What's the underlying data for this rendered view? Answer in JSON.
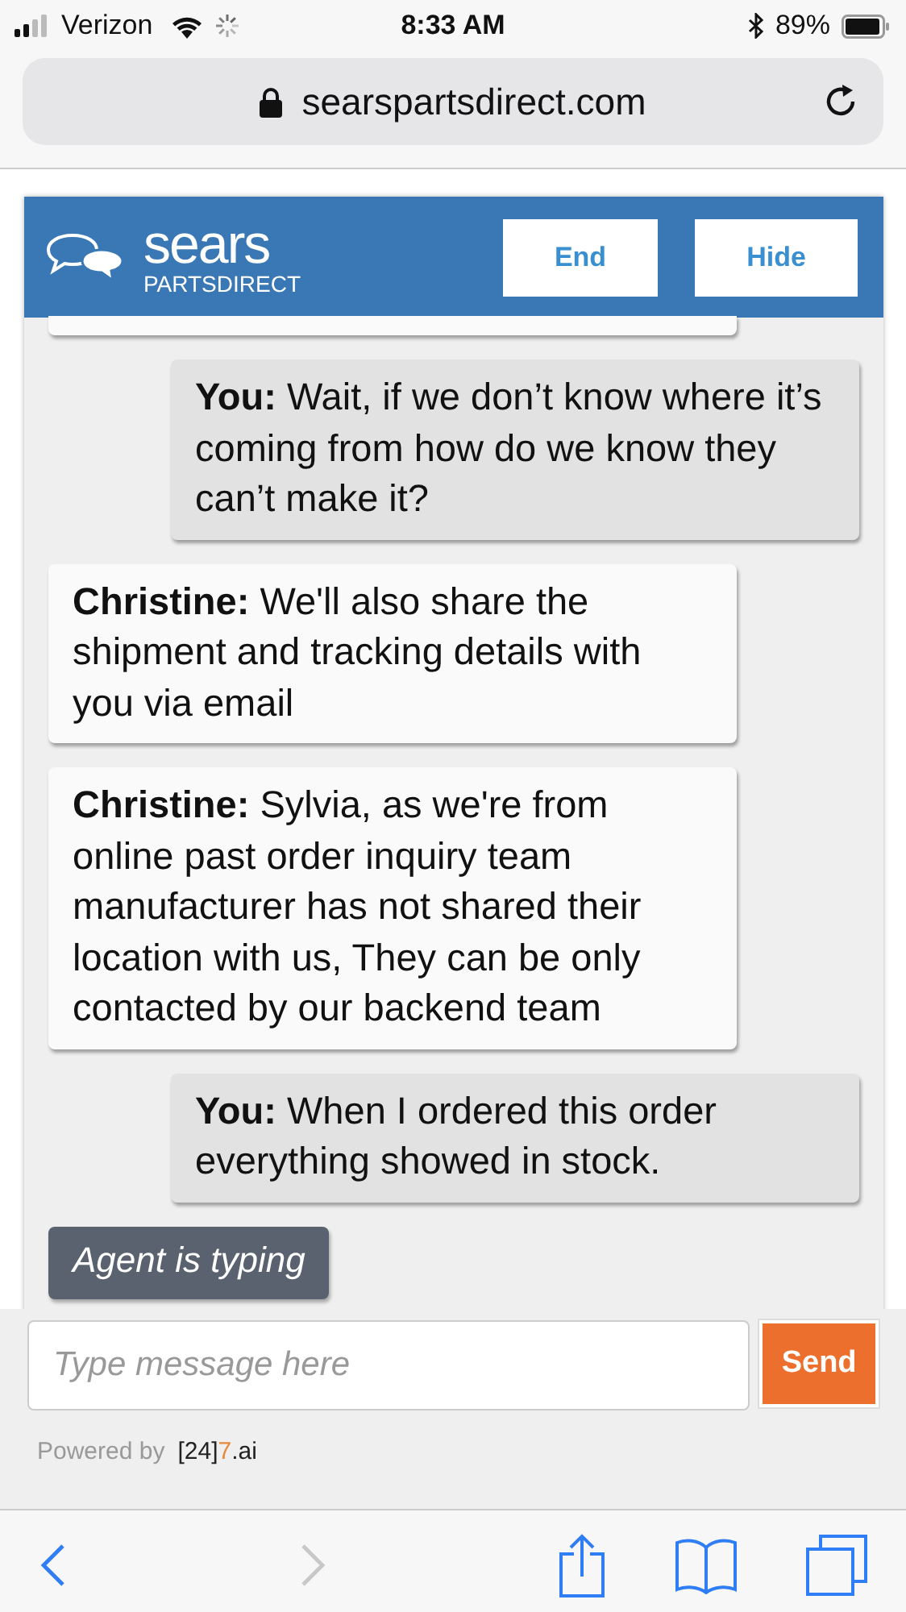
{
  "status_bar": {
    "carrier": "Verizon",
    "time": "8:33 AM",
    "battery": "89%"
  },
  "browser": {
    "url": "searspartsdirect.com"
  },
  "chat": {
    "brand": "sears",
    "brand_sub": "PARTSDIRECT",
    "buttons": [
      "End",
      "Hide"
    ],
    "messages": [
      {
        "kind": "user",
        "text": "**You:** Wait, if we don’t know where it’s coming from how do we know they can’t make it?"
      },
      {
        "kind": "agent",
        "text": "**Christine:** We'll also share the shipment and tracking details with you via email"
      },
      {
        "kind": "agent",
        "text": "**Christine:** Sylvia, as we're from online past order inquiry team manufacturer has not shared their location with us, They can be only contacted by our backend team"
      },
      {
        "kind": "user",
        "text": "**You:** When I ordered this order everything showed in stock."
      }
    ],
    "typing": "Agent is typing",
    "input": {
      "placeholder": "Type message here"
    },
    "send": "Send",
    "powered_by": "Powered by",
    "vendor": [
      {
        "text": "[24]",
        "color": "#222222"
      },
      {
        "text": "7",
        "color": "#e8883a"
      },
      {
        "text": ".ai",
        "color": "#222222"
      }
    ]
  },
  "toolbar": [
    {
      "kind": "back",
      "disabled": false
    },
    {
      "kind": "forward",
      "disabled": true
    },
    {
      "kind": "share",
      "disabled": false
    },
    {
      "kind": "bookmarks",
      "disabled": false
    },
    {
      "kind": "tabs",
      "disabled": false
    }
  ]
}
